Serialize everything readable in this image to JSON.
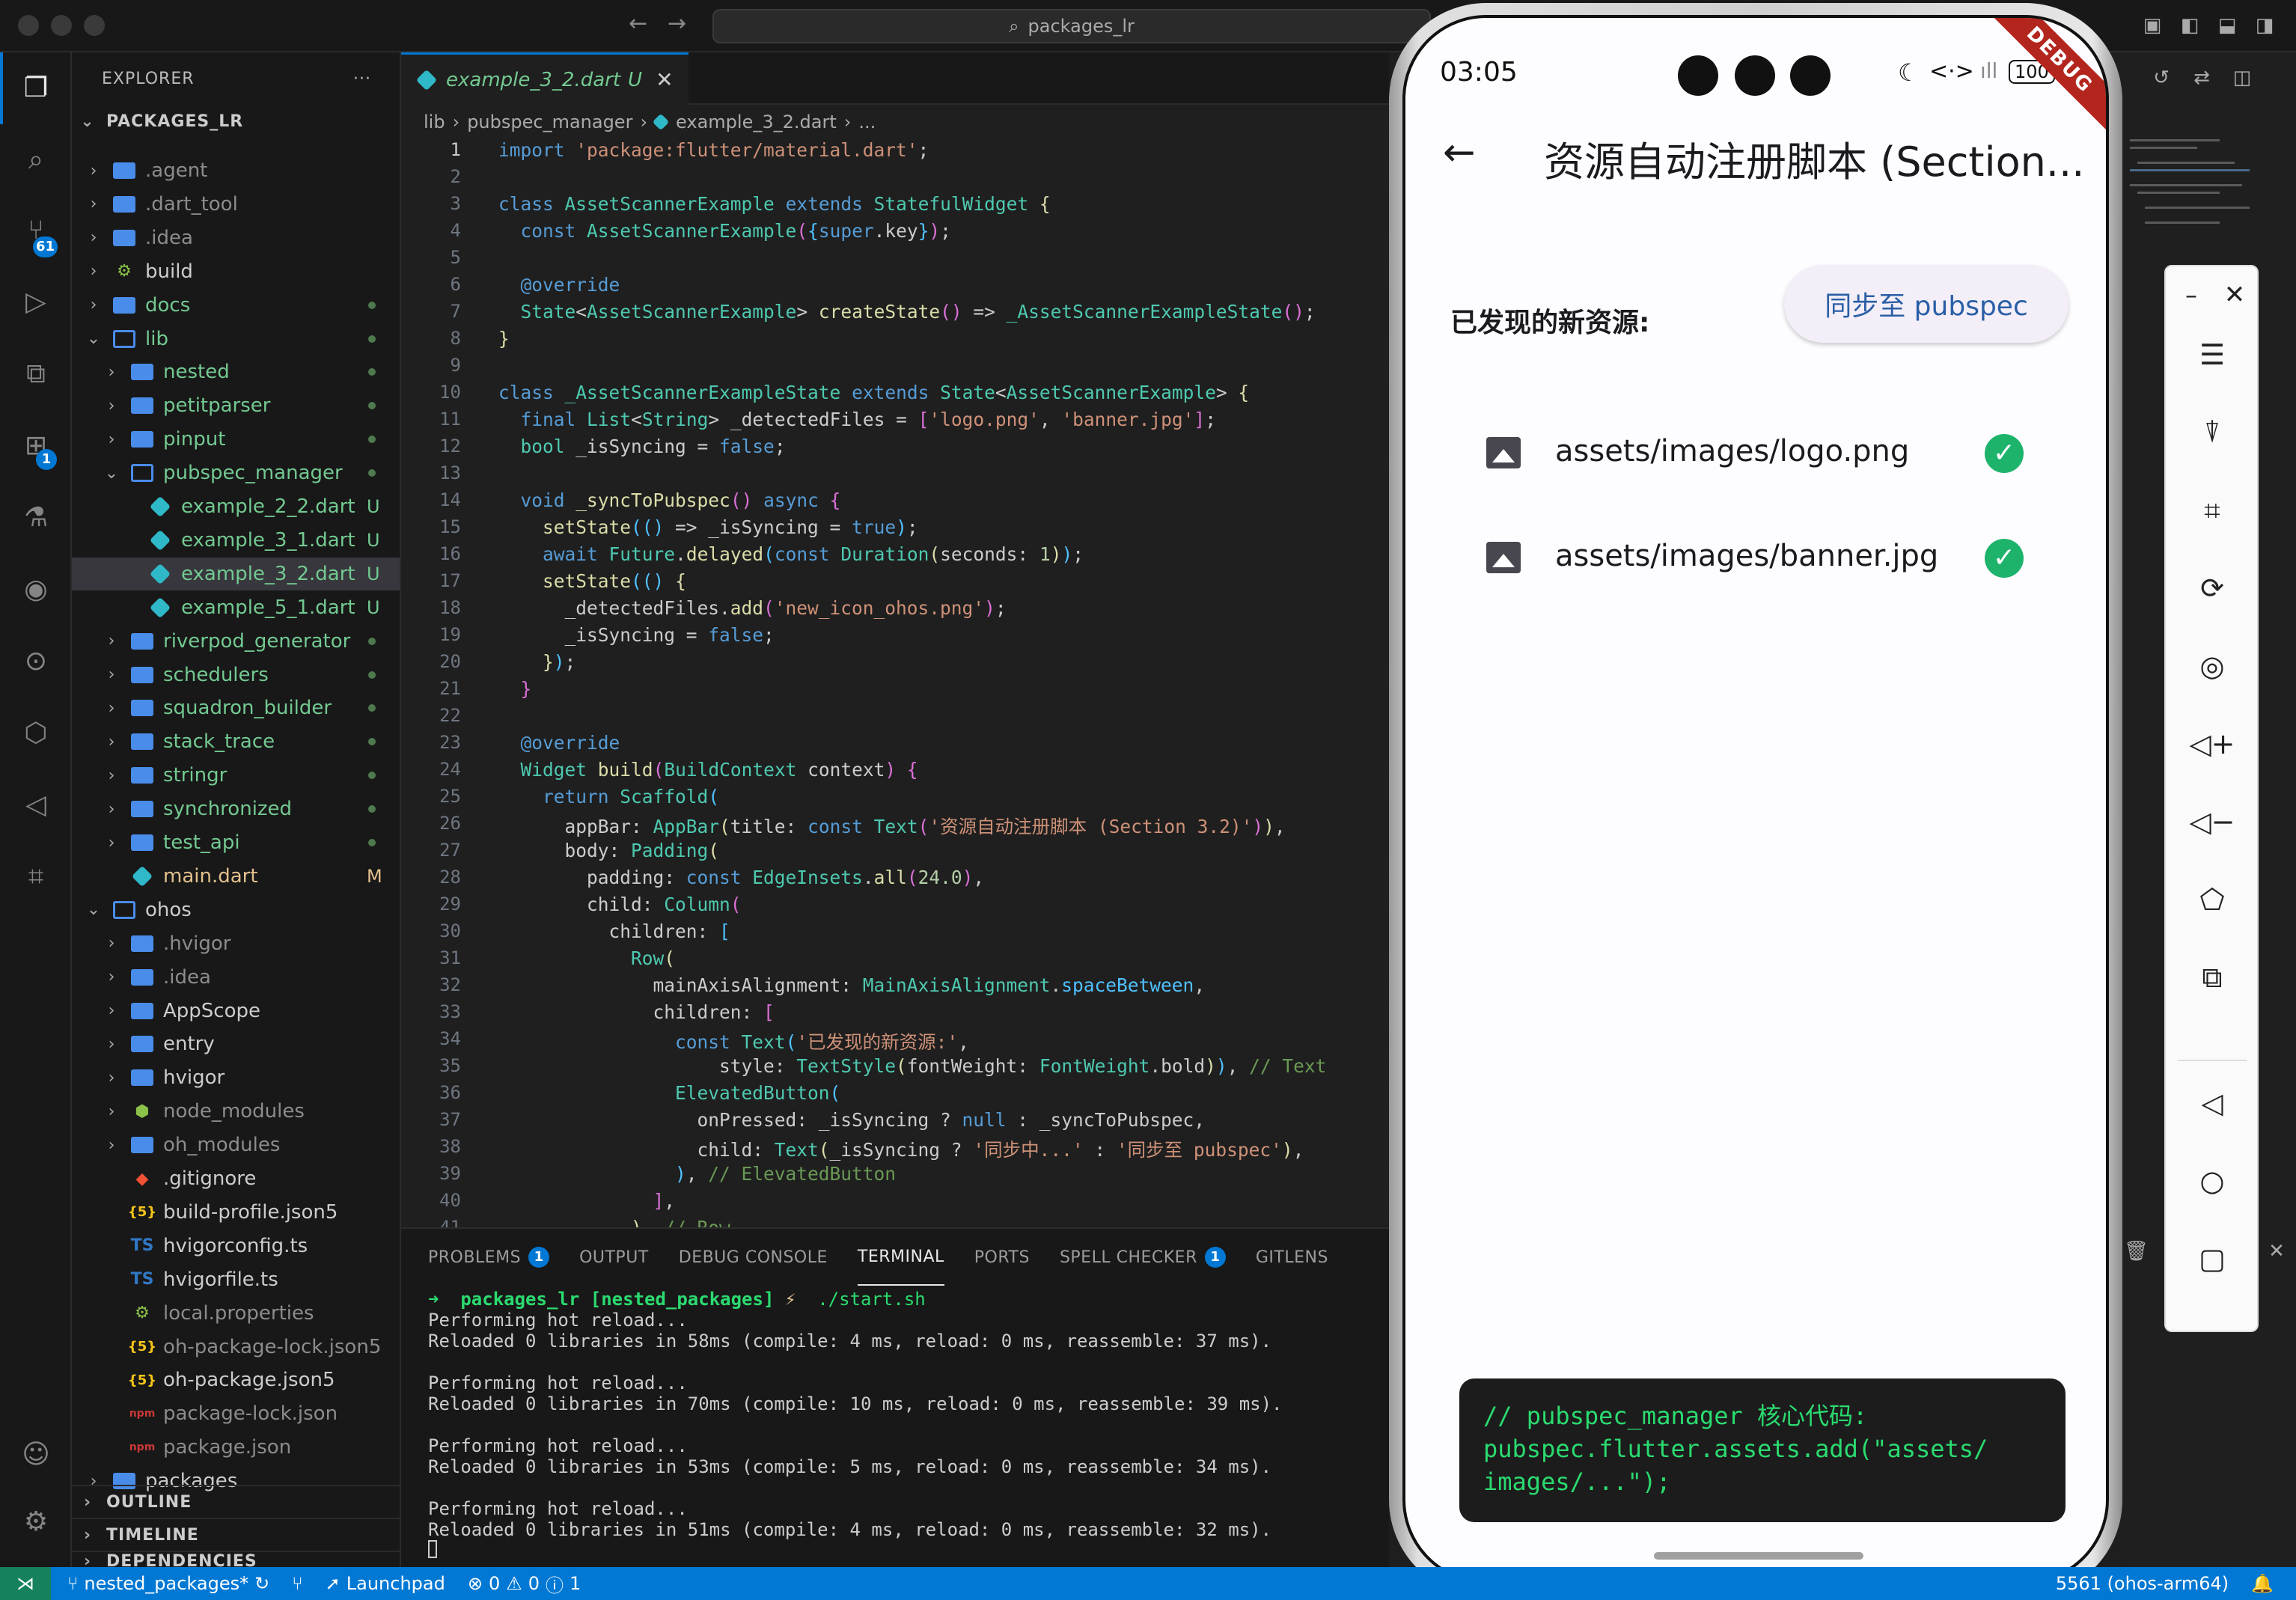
{
  "window": {
    "search_placeholder": "packages_lr"
  },
  "activity_bar": {
    "scm_badge": "61",
    "extensions_badge": "1"
  },
  "sidebar": {
    "header": "EXPLORER",
    "more": "···",
    "root": "PACKAGES_LR",
    "items": [
      {
        "label": ".agent"
      },
      {
        "label": ".dart_tool"
      },
      {
        "label": ".idea"
      },
      {
        "label": "build"
      },
      {
        "label": "docs"
      },
      {
        "label": "lib"
      },
      {
        "label": "nested"
      },
      {
        "label": "petitparser"
      },
      {
        "label": "pinput"
      },
      {
        "label": "pubspec_manager"
      },
      {
        "label": "example_2_2.dart",
        "deco": "U"
      },
      {
        "label": "example_3_1.dart",
        "deco": "U"
      },
      {
        "label": "example_3_2.dart",
        "deco": "U"
      },
      {
        "label": "example_5_1.dart",
        "deco": "U"
      },
      {
        "label": "riverpod_generator"
      },
      {
        "label": "schedulers"
      },
      {
        "label": "squadron_builder"
      },
      {
        "label": "stack_trace"
      },
      {
        "label": "stringr"
      },
      {
        "label": "synchronized"
      },
      {
        "label": "test_api"
      },
      {
        "label": "main.dart",
        "deco": "M"
      },
      {
        "label": "ohos"
      },
      {
        "label": ".hvigor"
      },
      {
        "label": ".idea"
      },
      {
        "label": "AppScope"
      },
      {
        "label": "entry"
      },
      {
        "label": "hvigor"
      },
      {
        "label": "node_modules"
      },
      {
        "label": "oh_modules"
      },
      {
        "label": ".gitignore"
      },
      {
        "label": "build-profile.json5"
      },
      {
        "label": "hvigorconfig.ts"
      },
      {
        "label": "hvigorfile.ts"
      },
      {
        "label": "local.properties"
      },
      {
        "label": "oh-package-lock.json5"
      },
      {
        "label": "oh-package.json5"
      },
      {
        "label": "package-lock.json"
      },
      {
        "label": "package.json"
      },
      {
        "label": "packages"
      }
    ],
    "sections": {
      "outline": "OUTLINE",
      "timeline": "TIMELINE",
      "dependencies": "DEPENDENCIES"
    }
  },
  "editor": {
    "tab": {
      "label": "example_3_2.dart",
      "status": "U"
    },
    "breadcrumb": [
      "lib",
      "pubspec_manager",
      "example_3_2.dart",
      "..."
    ],
    "line_numbers": [
      "1",
      "2",
      "3",
      "4",
      "5",
      "6",
      "7",
      "8",
      "9",
      "10",
      "11",
      "12",
      "13",
      "14",
      "15",
      "16",
      "17",
      "18",
      "19",
      "20",
      "21",
      "22",
      "23",
      "24",
      "25",
      "26",
      "27",
      "28",
      "29",
      "30",
      "31",
      "32",
      "33",
      "34",
      "35",
      "36",
      "37",
      "38",
      "39",
      "40",
      "41"
    ]
  },
  "panel": {
    "tabs": [
      "PROBLEMS",
      "OUTPUT",
      "DEBUG CONSOLE",
      "TERMINAL",
      "PORTS",
      "SPELL CHECKER",
      "GITLENS"
    ],
    "problems_badge": "1",
    "spell_badge": "1",
    "prompt_dir": "packages_lr",
    "prompt_branch": "[nested_packages]",
    "prompt_symbol": "⚡",
    "prompt_cmd": "./start.sh",
    "lines": [
      "Performing hot reload...",
      "Reloaded 0 libraries in 58ms (compile: 4 ms, reload: 0 ms, reassemble: 37 ms).",
      "",
      "Performing hot reload...",
      "Reloaded 0 libraries in 70ms (compile: 10 ms, reload: 0 ms, reassemble: 39 ms).",
      "",
      "Performing hot reload...",
      "Reloaded 0 libraries in 53ms (compile: 5 ms, reload: 0 ms, reassemble: 34 ms).",
      "",
      "Performing hot reload...",
      "Reloaded 0 libraries in 51ms (compile: 4 ms, reload: 0 ms, reassemble: 32 ms)."
    ]
  },
  "phone": {
    "time": "03:05",
    "battery": "100",
    "debug": "DEBUG",
    "title": "资源自动注册脚本 (Section...",
    "found_label": "已发现的新资源:",
    "sync_button": "同步至 pubspec",
    "assets": [
      "assets/images/logo.png",
      "assets/images/banner.jpg"
    ],
    "code_lines": [
      "// pubspec_manager 核心代码:",
      "pubspec.flutter.assets.add(\"assets/",
      "images/...\");"
    ]
  },
  "statusbar": {
    "branch": "nested_packages*",
    "launchpad": "Launchpad",
    "errors": "0",
    "warnings": "0",
    "info": "1",
    "device": "5561 (ohos-arm64)"
  },
  "colors": {
    "accent": "#0078d4",
    "git_untracked": "#73c991",
    "git_modified": "#e2c08d",
    "check": "#1eb36b"
  }
}
